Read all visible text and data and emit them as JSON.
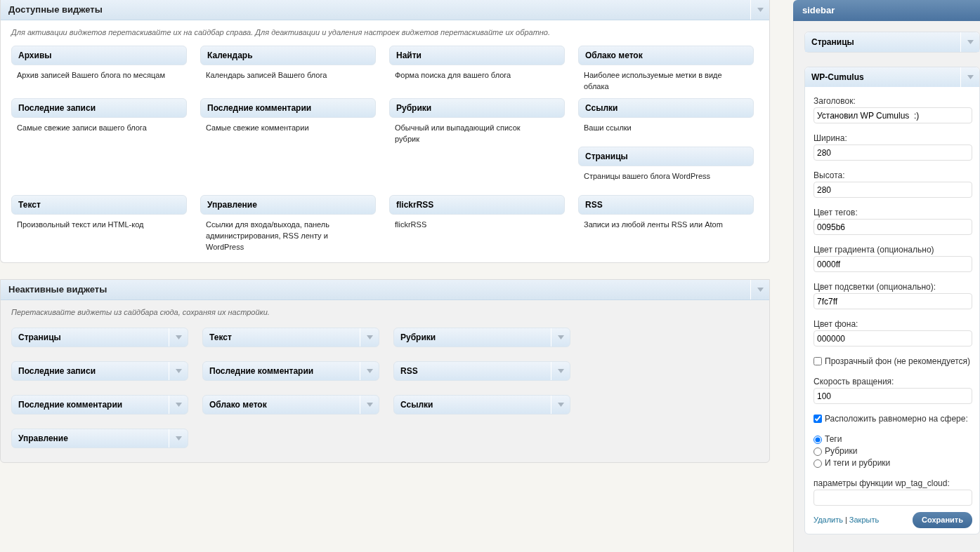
{
  "available": {
    "title": "Доступные виджеты",
    "hint": "Для активации виджетов перетаскивайте их на сайдбар справа. Для деактивации и удаления настроек виджетов перетаскивайте их обратно.",
    "widgets": [
      {
        "title": "Архивы",
        "description": "Архив записей Вашего блога по месяцам"
      },
      {
        "title": "Календарь",
        "description": "Календарь записей Вашего блога"
      },
      {
        "title": "Найти",
        "description": "Форма поиска для вашего блога"
      },
      {
        "title": "Облако меток",
        "description": "Наиболее используемые метки в виде облака"
      },
      {
        "title": "Последние записи",
        "description": "Самые свежие записи вашего блога"
      },
      {
        "title": "Последние комментарии",
        "description": "Самые свежие комментарии"
      },
      {
        "title": "Рубрики",
        "description": "Обычный или выпадающий список рубрик"
      },
      {
        "title": "Ссылки",
        "description": "Ваши ссылки"
      },
      {
        "title": "Страницы",
        "description": "Страницы вашего блога WordPress"
      },
      {
        "title": "Текст",
        "description": "Произвольный текст или HTML-код"
      },
      {
        "title": "Управление",
        "description": "Ссылки для входа/выхода, панель администрирования, RSS ленту и WordPress"
      },
      {
        "title": "flickrRSS",
        "description": "flickrRSS"
      },
      {
        "title": "RSS",
        "description": "Записи из любой ленты RSS или Atom"
      }
    ]
  },
  "inactive": {
    "title": "Неактивные виджеты",
    "hint": "Перетаскивайте виджеты из сайдбара сюда, сохраняя их настройки.",
    "widgets": [
      {
        "title": "Страницы"
      },
      {
        "title": "Текст"
      },
      {
        "title": "Рубрики"
      },
      {
        "title": "Последние записи"
      },
      {
        "title": "Последние комментарии"
      },
      {
        "title": "RSS"
      },
      {
        "title": "Последние комментарии"
      },
      {
        "title": "Облако меток"
      },
      {
        "title": "Ссылки"
      },
      {
        "title": "Управление"
      }
    ]
  },
  "sidebar": {
    "title": "sidebar",
    "widgets": [
      {
        "title": "Страницы",
        "expanded": false
      },
      {
        "title": "WP-Cumulus",
        "expanded": true,
        "form": [
          {
            "kind": "text",
            "label": "Заголовок:",
            "value": "Установил WP Cumulus  :)"
          },
          {
            "kind": "text",
            "label": "Ширина:",
            "value": "280"
          },
          {
            "kind": "text",
            "label": "Высота:",
            "value": "280"
          },
          {
            "kind": "text",
            "label": "Цвет тегов:",
            "value": "0095b6"
          },
          {
            "kind": "text",
            "label": "Цвет градиента (опционально)",
            "value": "0000ff"
          },
          {
            "kind": "text",
            "label": "Цвет подсветки (опционально):",
            "value": "7fc7ff"
          },
          {
            "kind": "text",
            "label": "Цвет фона:",
            "value": "000000"
          },
          {
            "kind": "checkbox",
            "label": "Прозрачный фон (не рекомендуется)",
            "checked": false
          },
          {
            "kind": "text",
            "label": "Скорость вращения:",
            "value": "100"
          },
          {
            "kind": "checkbox",
            "label": "Расположить равномерно на сфере:",
            "checked": true
          },
          {
            "kind": "radio",
            "label": "Теги",
            "selected": true
          },
          {
            "kind": "radio",
            "label": "Рубрики",
            "selected": false
          },
          {
            "kind": "radio",
            "label": "И теги и рубрики",
            "selected": false
          },
          {
            "kind": "text",
            "label": "параметры функции wp_tag_cloud:"
          }
        ],
        "links": [
          "Удалить",
          "Закрыть"
        ],
        "separator": "|",
        "button": "Сохранить"
      }
    ]
  }
}
